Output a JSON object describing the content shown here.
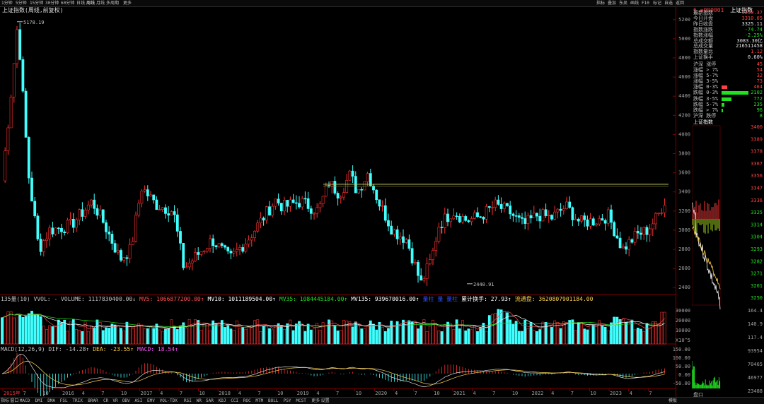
{
  "toolbar": {
    "periods": [
      "1分钟",
      "5分钟",
      "15分钟",
      "30分钟",
      "60分钟",
      "日线",
      "周线",
      "月线",
      "多周期",
      "更多"
    ],
    "active_period": "周线",
    "right_items": [
      "指标",
      "叠加",
      "东吴",
      "画线",
      "F10",
      "标记",
      "自选",
      "返回"
    ]
  },
  "main_chart": {
    "title": "上证指数(周线,前复权)",
    "high_label": "5178.19",
    "low_label": "2440.91",
    "y_ticks": [
      "5200",
      "5000",
      "4800",
      "4600",
      "4400",
      "4200",
      "4000",
      "3800",
      "3600",
      "3400",
      "3200",
      "3000",
      "2800",
      "2600",
      "2400"
    ]
  },
  "volume_pane": {
    "legend": [
      {
        "text": "135量(10) VVOL: - VOLUME: 1117830400.00↓",
        "color": "#c0c0c0"
      },
      {
        "text": "MV5: 1066877200.00↑",
        "color": "#ff5050"
      },
      {
        "text": "MV10: 1011189504.00↑",
        "color": "#ffffff"
      },
      {
        "text": "MV35: 1084445184.00↑",
        "color": "#20e020"
      },
      {
        "text": "MV135: 939670016.00↑",
        "color": "#ffffff"
      },
      {
        "text": "量柱 量 量柱",
        "color": "#3050ff"
      },
      {
        "text": "累计换手: 27.93↑",
        "color": "#ffffff"
      },
      {
        "text": "流通盘: 3620807901184.00",
        "color": "#ffd24a"
      }
    ],
    "y_ticks": [
      "30000",
      "20000",
      "10000",
      "X10^5"
    ]
  },
  "macd_pane": {
    "legend": [
      {
        "text": "MACD(12,26,9) DIF: -14.28↑",
        "color": "#c0c0c0"
      },
      {
        "text": "DEA: -23.55↑",
        "color": "#ffd24a"
      },
      {
        "text": "MACD: 18.54↑",
        "color": "#ff50ff"
      }
    ],
    "y_ticks": [
      "150.00",
      "100.00",
      "50.00",
      "0.00",
      "-50.00"
    ]
  },
  "x_axis": [
    "2015年",
    "7",
    "10",
    "2016",
    "4",
    "7",
    "10",
    "2017",
    "4",
    "7",
    "10",
    "2018",
    "4",
    "7",
    "10",
    "2019",
    "4",
    "7",
    "10",
    "2020",
    "4",
    "7",
    "10",
    "2021",
    "4",
    "7",
    "10",
    "2022",
    "4",
    "7",
    "10",
    "2023",
    "4",
    "7"
  ],
  "quote_panel": {
    "code": "6 ≡000001",
    "name": "上证指数",
    "rows": [
      {
        "label": "最新指数",
        "value": "3250.37",
        "color": "#ff4040"
      },
      {
        "label": "今日开盘",
        "value": "3310.65",
        "color": "#ff4040"
      },
      {
        "label": "昨日收盘",
        "value": "3325.11",
        "color": "#e0e0e0"
      },
      {
        "label": "指数涨跌",
        "value": "-74.74",
        "color": "#20e020"
      },
      {
        "label": "指数涨幅",
        "value": "-2.25%",
        "color": "#20e020"
      },
      {
        "label": "总成交额",
        "value": "3083.30亿",
        "color": "#e0e0e0"
      },
      {
        "label": "总成交量",
        "value": "216511458",
        "color": "#e0e0e0"
      },
      {
        "label": "指数量比",
        "value": "1.12",
        "color": "#ff4040"
      },
      {
        "label": "上证换手",
        "value": "0.60%",
        "color": "#e0e0e0"
      }
    ],
    "breadth_header": {
      "label": "沪深 涨停",
      "value": "45",
      "color": "#ff4040"
    },
    "breadth": [
      {
        "label": "涨幅 > 7%",
        "value": "54",
        "color": "#ff4040",
        "bar": 0
      },
      {
        "label": "涨幅 5-7%",
        "value": "32",
        "color": "#ff4040",
        "bar": 0
      },
      {
        "label": "涨幅 3-5%",
        "value": "73",
        "color": "#ff4040",
        "bar": 0
      },
      {
        "label": "涨幅 0-3%",
        "value": "464",
        "color": "#ff4040",
        "bar": 0.2
      },
      {
        "label": "跌幅 0-3%",
        "value": "2102",
        "color": "#20e020",
        "bar": 1
      },
      {
        "label": "跌幅 3-5%",
        "value": "772",
        "color": "#20e020",
        "bar": 0.37
      },
      {
        "label": "跌幅 5-7%",
        "value": "235",
        "color": "#20e020",
        "bar": 0.11
      },
      {
        "label": "跌幅 > 7%",
        "value": "96",
        "color": "#20e020",
        "bar": 0.05
      }
    ],
    "breadth_footer": {
      "label": "沪深 跌停",
      "value": "8",
      "color": "#20e020"
    },
    "mini_title": "上证指数",
    "mini_ticks": [
      "3400",
      "3389",
      "3378",
      "3367",
      "3356",
      "3347",
      "3336",
      "3325",
      "3314",
      "3304",
      "3293",
      "3282",
      "3271",
      "3261",
      "3250"
    ],
    "mini_vol_ticks": [
      "164.4",
      "140.9",
      "117.4",
      "93954",
      "70465",
      "46977",
      "23488"
    ],
    "mini_footer": "盘口"
  },
  "bottombar": {
    "items": [
      "指标",
      "窗口",
      "MACD",
      "DMI",
      "DMA",
      "FSL",
      "TRIX",
      "BRAR",
      "CR",
      "VR",
      "OBV",
      "ASI",
      "EMV",
      "VOL-TDX",
      "RSI",
      "WR",
      "SAR",
      "KDJ",
      "CCI",
      "ROC",
      "MTM",
      "BOLL",
      "PSY",
      "MCST",
      "更多",
      "设置"
    ],
    "right": "模板"
  }
}
